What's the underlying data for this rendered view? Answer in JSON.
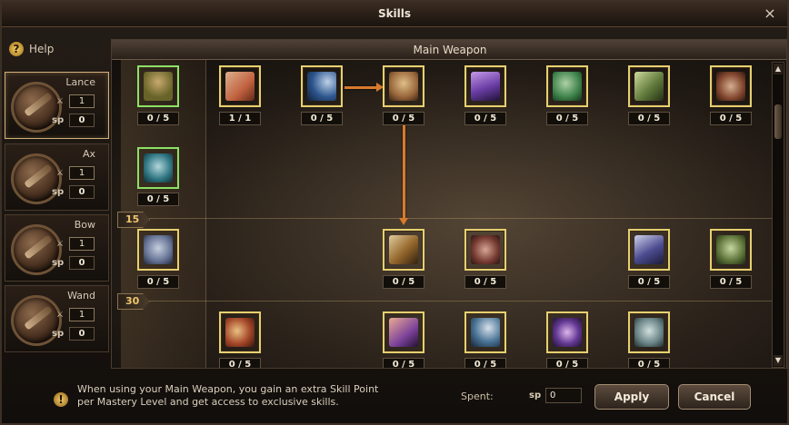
{
  "window": {
    "title": "Skills",
    "close_icon": "×"
  },
  "help": {
    "icon": "?",
    "label": "Help"
  },
  "weapons": [
    {
      "name": "Lance",
      "level": "1",
      "sp_label": "sp",
      "sp": "0",
      "active": true
    },
    {
      "name": "Ax",
      "level": "1",
      "sp_label": "sp",
      "sp": "0",
      "active": false
    },
    {
      "name": "Bow",
      "level": "1",
      "sp_label": "sp",
      "sp": "0",
      "active": false
    },
    {
      "name": "Wand",
      "level": "1",
      "sp_label": "sp",
      "sp": "0",
      "active": false
    }
  ],
  "tree": {
    "header": "Main Weapon",
    "tiers": [
      "15",
      "30"
    ]
  },
  "skills": [
    {
      "count": "0 / 5",
      "color": "#6e6a2a"
    },
    {
      "count": "1 / 1",
      "color": "#d46a45"
    },
    {
      "count": "0 / 5",
      "color": "#2f5d9c"
    },
    {
      "count": "0 / 5",
      "color": "#a56f3f"
    },
    {
      "count": "0 / 5",
      "color": "#7140b5"
    },
    {
      "count": "0 / 5",
      "color": "#3e8b4d"
    },
    {
      "count": "0 / 5",
      "color": "#6a8641"
    },
    {
      "count": "0 / 5",
      "color": "#8e4c31"
    },
    {
      "count": "0 / 5",
      "color": "#2c7c8b"
    },
    {
      "count": "0 / 5",
      "color": "#6a7aa1"
    },
    {
      "count": "0 / 5",
      "color": "#9b6a2a"
    },
    {
      "count": "0 / 5",
      "color": "#7a3a32"
    },
    {
      "count": "0 / 5",
      "color": "#4d4e9c"
    },
    {
      "count": "0 / 5",
      "color": "#607a3a"
    },
    {
      "count": "0 / 5",
      "color": "#b24b2a"
    },
    {
      "count": "0 / 5",
      "color": "#8445a8"
    },
    {
      "count": "0 / 5",
      "color": "#4a7aa1"
    },
    {
      "count": "0 / 5",
      "color": "#693ba2"
    },
    {
      "count": "0 / 5",
      "color": "#6d8b8f"
    }
  ],
  "info": {
    "icon": "!",
    "text": "When using your Main Weapon, you gain an extra Skill Point per Mastery Level and get access to exclusive skills."
  },
  "footer": {
    "spent_label": "Spent:",
    "sp_label": "sp",
    "spent_value": "0",
    "apply": "Apply",
    "cancel": "Cancel"
  }
}
